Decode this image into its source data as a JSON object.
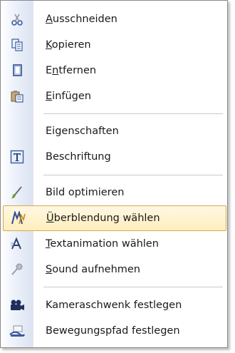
{
  "menu": {
    "items": [
      {
        "pre": "",
        "u": "A",
        "post": "usschneiden",
        "icon": "scissors-icon"
      },
      {
        "pre": "",
        "u": "K",
        "post": "opieren",
        "icon": "copy-icon"
      },
      {
        "pre": "E",
        "u": "n",
        "post": "tfernen",
        "icon": "delete-page-icon"
      },
      {
        "pre": "",
        "u": "E",
        "post": "infügen",
        "icon": "paste-icon"
      },
      {
        "pre": "Eigenschaften",
        "u": "",
        "post": "",
        "icon": ""
      },
      {
        "pre": "Beschriftung",
        "u": "",
        "post": "",
        "icon": "text-caption-icon"
      },
      {
        "pre": "Bild optimieren",
        "u": "",
        "post": "",
        "icon": "brush-icon"
      },
      {
        "pre": "",
        "u": "Ü",
        "post": "berblendung wählen",
        "icon": "transition-icon"
      },
      {
        "pre": "",
        "u": "T",
        "post": "extanimation wählen",
        "icon": "text-animation-icon"
      },
      {
        "pre": "",
        "u": "S",
        "post": "ound aufnehmen",
        "icon": "microphone-icon"
      },
      {
        "pre": "Kameraschwenk festlegen",
        "u": "",
        "post": "",
        "icon": "camera-icon"
      },
      {
        "pre": "Bewegungspfad festlegen",
        "u": "",
        "post": "",
        "icon": "motion-path-icon"
      }
    ],
    "highlighted_index": 7
  },
  "colors": {
    "highlight_border": "#d9a945",
    "highlight_fill": "#ffeebd",
    "icon_blue": "#2f4f8f"
  }
}
